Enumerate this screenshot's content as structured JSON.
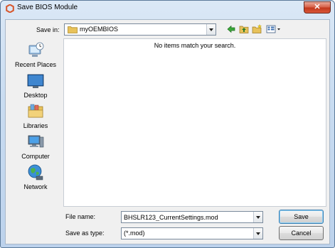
{
  "window": {
    "title": "Save BIOS Module",
    "close_glyph": "✕"
  },
  "toolbar": {
    "save_in_label": "Save in:",
    "save_in_value": "myOEMBIOS"
  },
  "places": [
    {
      "label": "Recent Places",
      "icon": "recent-places-icon"
    },
    {
      "label": "Desktop",
      "icon": "desktop-icon"
    },
    {
      "label": "Libraries",
      "icon": "libraries-icon"
    },
    {
      "label": "Computer",
      "icon": "computer-icon"
    },
    {
      "label": "Network",
      "icon": "network-icon"
    }
  ],
  "filelist": {
    "empty_message": "No items match your search."
  },
  "form": {
    "filename_label": "File name:",
    "filename_value": "BHSLR123_CurrentSettings.mod",
    "savetype_label": "Save as type:",
    "savetype_value": "(*.mod)"
  },
  "buttons": {
    "save": "Save",
    "cancel": "Cancel"
  },
  "colors": {
    "accent": "#3c7fb1",
    "close": "#c2391d",
    "folder": "#e8c25a"
  }
}
